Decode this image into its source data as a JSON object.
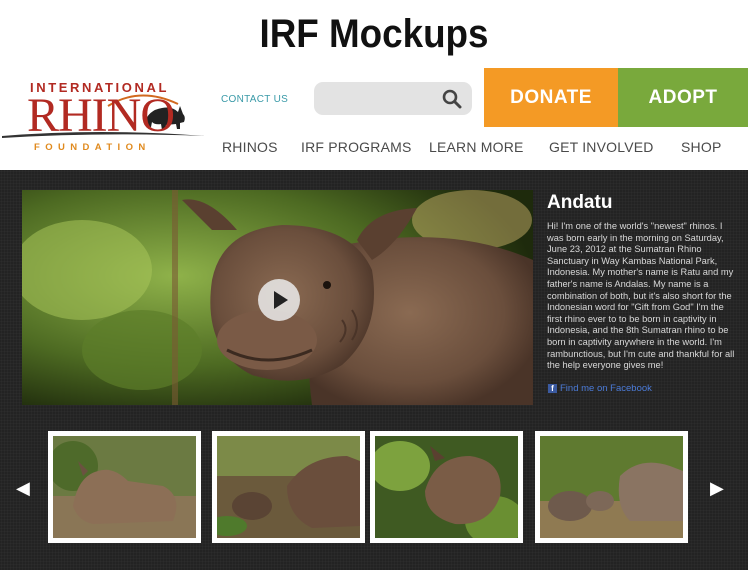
{
  "mockup_title": "IRF Mockups",
  "logo": {
    "line1": "INTERNATIONAL",
    "line2": "RHINO",
    "line3": "FOUNDATION"
  },
  "header": {
    "contact_label": "CONTACT US",
    "search_placeholder": "",
    "donate_label": "DONATE",
    "adopt_label": "ADOPT"
  },
  "nav": {
    "items": [
      "RHINOS",
      "IRF PROGRAMS",
      "LEARN MORE",
      "GET INVOLVED",
      "SHOP"
    ]
  },
  "feature": {
    "name": "Andatu",
    "description": "Hi! I'm one of the world's \"newest\" rhinos. I was born early in the morning on Saturday, June 23, 2012 at the Sumatran Rhino Sanctuary in Way Kambas National Park, Indonesia. My mother's name is Ratu and my father's name is Andalas. My name is a combination of both, but it's also short for the Indonesian word for \"Gift from God\" I'm the first rhino ever to to be born in captivity in Indonesia, and the 8th Sumatran rhino to be born in captivity anywhere in the world. I'm rambunctious, but I'm cute and thankful for all the help everyone gives me!",
    "facebook_label": "Find me on Facebook"
  },
  "carousel": {
    "prev_glyph": "◀",
    "next_glyph": "▶"
  },
  "colors": {
    "donate": "#f49a25",
    "adopt": "#79a93c",
    "brand_red": "#b22a22",
    "brand_orange": "#e08a1e",
    "link_teal": "#3a9aa8",
    "background_dark": "#232323"
  }
}
